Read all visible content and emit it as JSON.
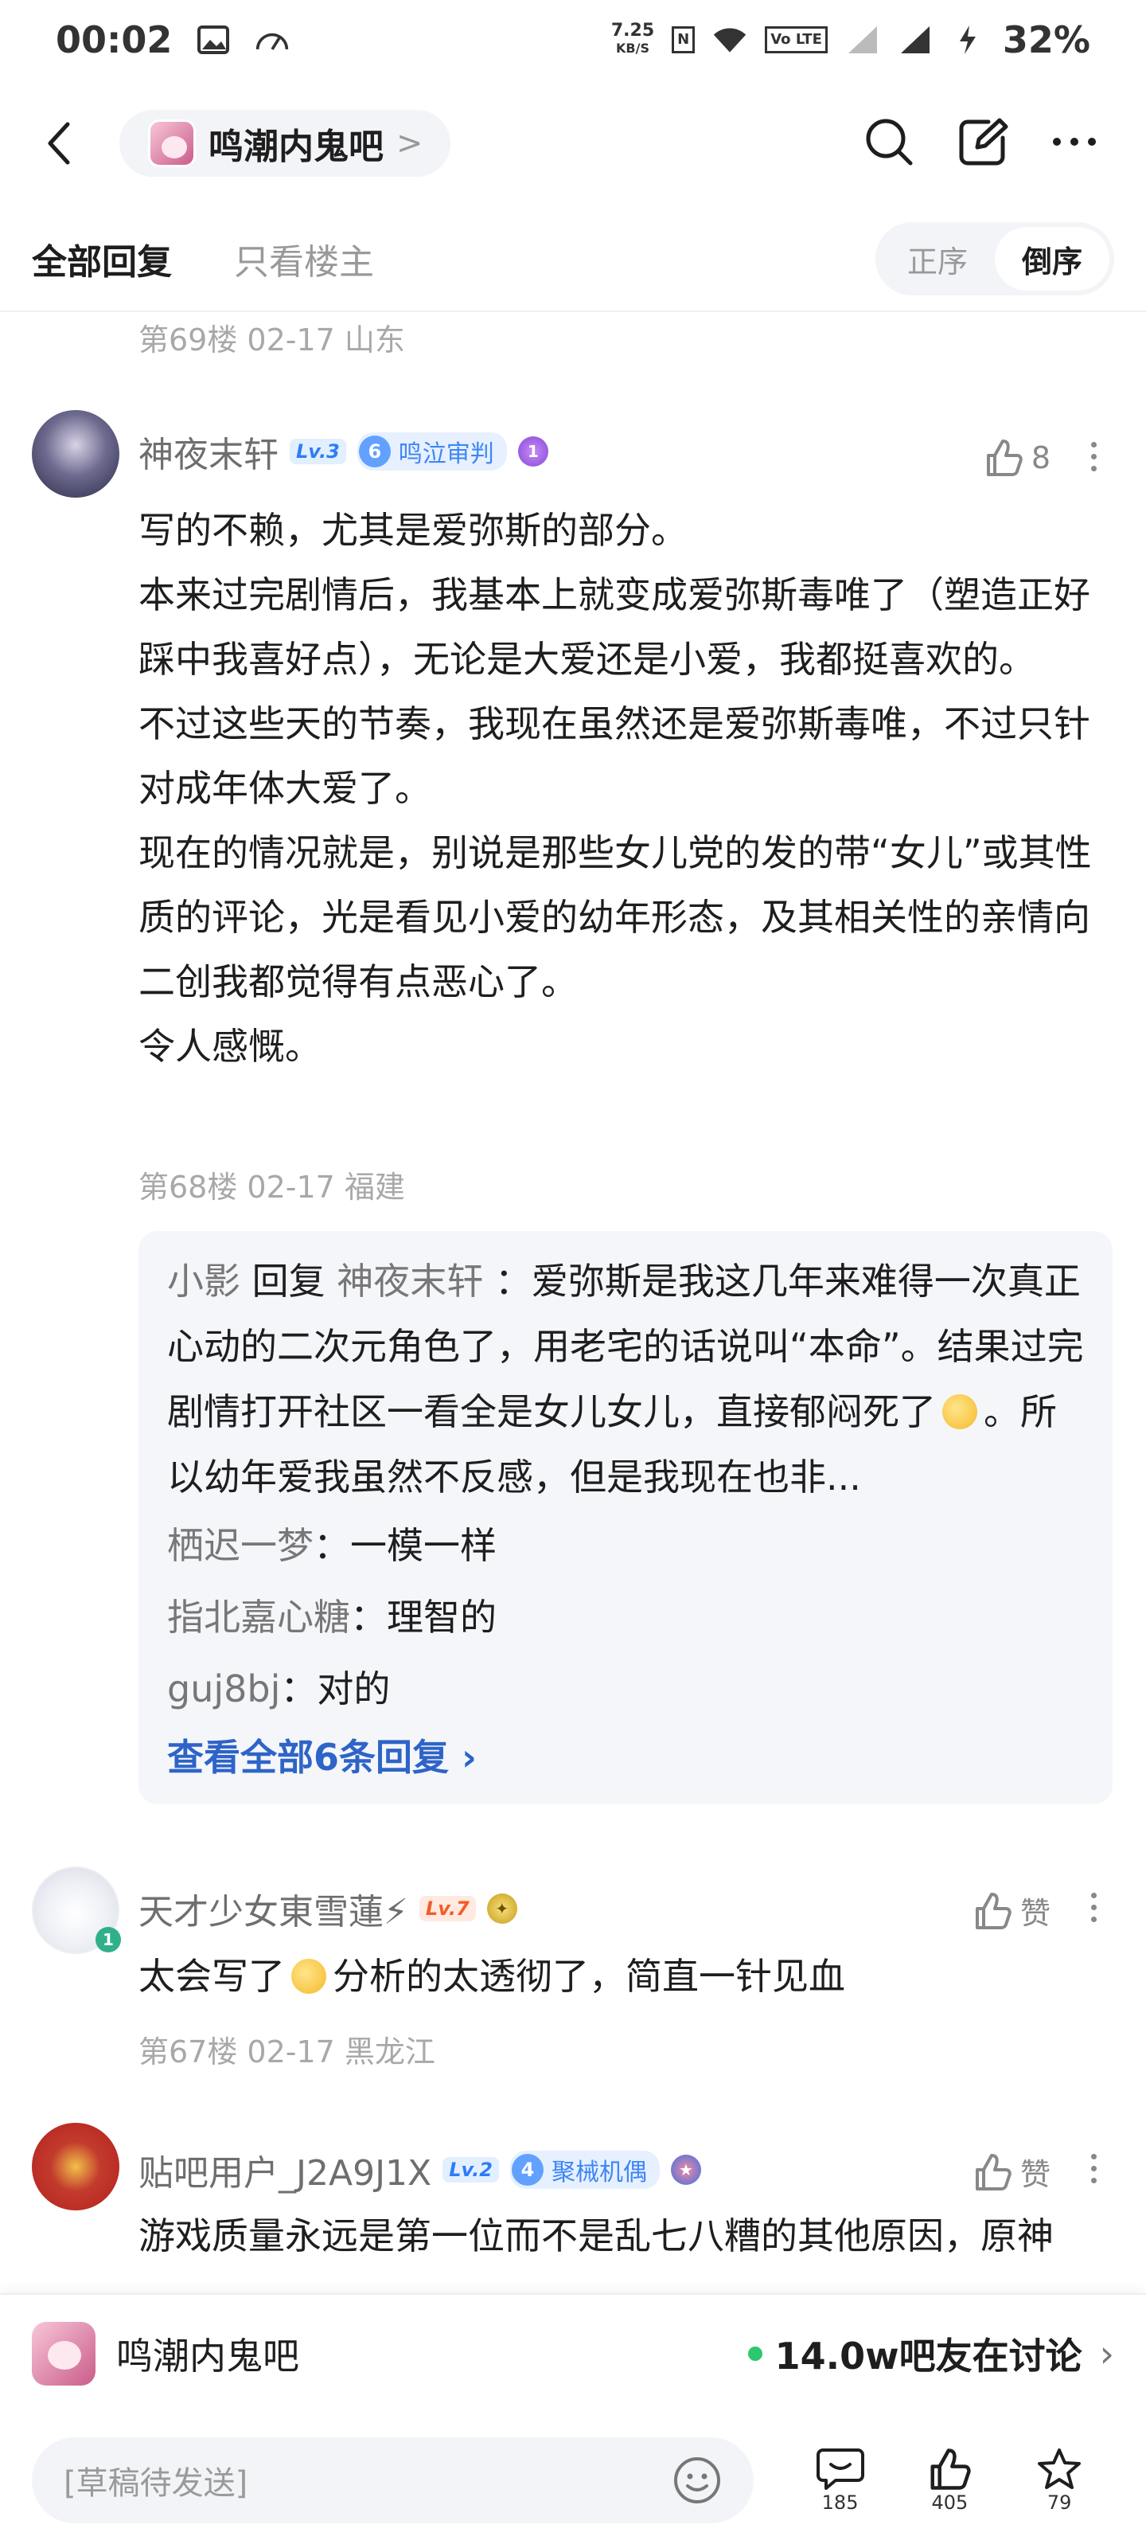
{
  "status_bar": {
    "time": "00:02",
    "net_speed": "7.25",
    "net_unit": "KB/S",
    "nfc": "N",
    "volte": "Vo LTE",
    "battery": "32%"
  },
  "nav": {
    "forum_name": "鸣潮内鬼吧",
    "chevron": ">"
  },
  "tabs": {
    "all_replies": "全部回复",
    "only_op": "只看楼主",
    "order_asc": "正序",
    "order_desc": "倒序"
  },
  "prev_floor_meta": "第69楼 02-17 山东",
  "posts": [
    {
      "username": "神夜末轩",
      "level": "Lv.3",
      "badge_num": "6",
      "badge_title": "鸣泣审判",
      "medal": "1",
      "like_count": "8",
      "lines": [
        "写的不赖，尤其是爱弥斯的部分。",
        "本来过完剧情后，我基本上就变成爱弥斯毒唯了（塑造正好踩中我喜好点），无论是大爱还是小爱，我都挺喜欢的。",
        "不过这些天的节奏，我现在虽然还是爱弥斯毒唯，不过只针对成年体大爱了。",
        "现在的情况就是，别说是那些女儿党的发的带“女儿”或其性质的评论，光是看见小爱的幼年形态，及其相关性的亲情向二创我都觉得有点恶心了。",
        "令人感慨。"
      ],
      "meta": "第68楼 02-17 福建",
      "reply_box": {
        "reply_user": "小影",
        "reply_word": "回复",
        "reply_target": "神夜末轩",
        "reply_text_a": "：爱弥斯是我这几年来难得一次真正心动的二次元角色了，用老宅的话说叫“本命”。结果过完剧情打开社区一看全是女儿女儿，直接郁闷死了",
        "reply_text_b": "。所以幼年爱我虽然不反感，但是我现在也非...",
        "sub_replies": [
          {
            "user": "栖迟一梦",
            "text": "：一模一样"
          },
          {
            "user": "指北嘉心糖",
            "text": "：理智的"
          },
          {
            "user": "guj8bj",
            "text": "：对的"
          }
        ],
        "view_all": "查看全部6条回复 ›"
      }
    },
    {
      "username": "天才少女東雪蓮⚡",
      "level": "Lv.7",
      "like_label": "赞",
      "avatar_badge": "1",
      "text_a": "太会写了",
      "text_b": "分析的太透彻了，简直一针见血",
      "meta": "第67楼 02-17 黑龙江"
    },
    {
      "username": "贴吧用户_J2A9J1X",
      "level": "Lv.2",
      "badge_num": "4",
      "badge_title": "聚械机偶",
      "like_label": "赞",
      "text": "游戏质量永远是第一位而不是乱七八糟的其他原因，原神"
    }
  ],
  "bottom_forum": {
    "name": "鸣潮内鬼吧",
    "discussing": "14.0w吧友在讨论",
    "chevron": "›"
  },
  "bottom_bar": {
    "draft_placeholder": "[草稿待发送]",
    "comment_count": "185",
    "like_count": "405",
    "star_count": "79"
  },
  "colors": {
    "link_blue": "#2e64c8",
    "meta_gray": "#a8a8a8",
    "reply_bg": "#f5f6fa",
    "online_green": "#2dc76d"
  }
}
